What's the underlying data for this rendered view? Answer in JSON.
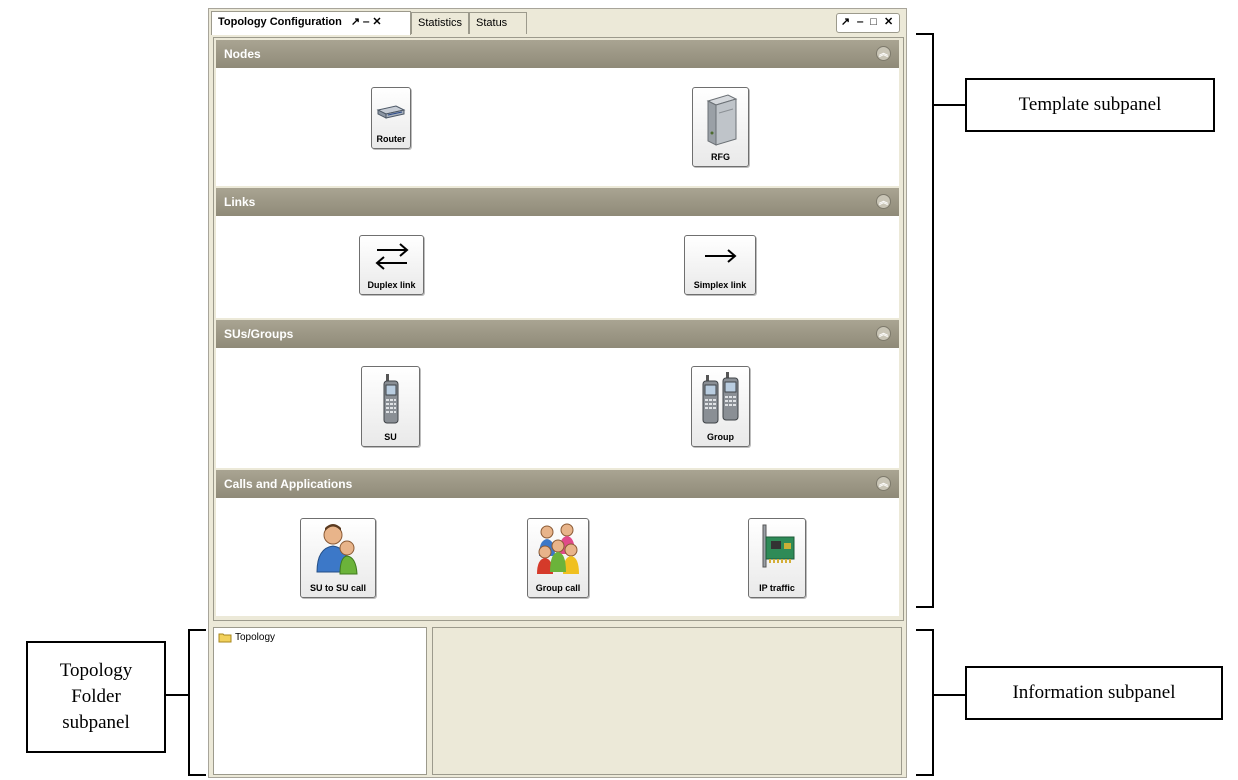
{
  "window": {
    "tabs": [
      {
        "label": "Topology Configuration",
        "controls": "↗ ‒ ✕"
      },
      {
        "label": "Statistics"
      },
      {
        "label": "Status"
      }
    ],
    "window_controls": "↗ ‒ □ ✕"
  },
  "sections": [
    {
      "title": "Nodes",
      "items": [
        {
          "label": "Router",
          "icon": "router-icon"
        },
        {
          "label": "RFG",
          "icon": "server-icon"
        }
      ]
    },
    {
      "title": "Links",
      "items": [
        {
          "label": "Duplex link",
          "icon": "duplex-arrow-icon"
        },
        {
          "label": "Simplex link",
          "icon": "simplex-arrow-icon"
        }
      ]
    },
    {
      "title": "SUs/Groups",
      "items": [
        {
          "label": "SU",
          "icon": "handset-icon"
        },
        {
          "label": "Group",
          "icon": "handset-group-icon"
        }
      ]
    },
    {
      "title": "Calls and Applications",
      "items": [
        {
          "label": "SU to SU call",
          "icon": "two-users-icon"
        },
        {
          "label": "Group call",
          "icon": "user-group-icon"
        },
        {
          "label": "IP traffic",
          "icon": "network-card-icon"
        }
      ]
    }
  ],
  "folder": {
    "root": "Topology"
  },
  "annotations": {
    "template": "Template subpanel",
    "folder": "Topology Folder subpanel",
    "information": "Information subpanel"
  }
}
